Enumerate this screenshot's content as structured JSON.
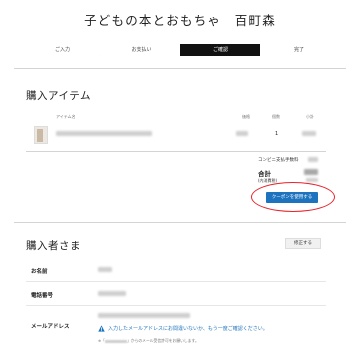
{
  "store": {
    "title": "子どもの本とおもちゃ　百町森"
  },
  "steps": [
    {
      "label": "ご入力",
      "active": false
    },
    {
      "label": "お支払い",
      "active": false
    },
    {
      "label": "ご確認",
      "active": true
    },
    {
      "label": "完了",
      "active": false
    }
  ],
  "items_section": {
    "heading": "購入アイテム",
    "columns": {
      "item": "アイテム名",
      "price": "価格",
      "qty": "個数",
      "subtotal": "小計"
    },
    "qty_value": "1"
  },
  "totals": {
    "fee_label": "コンビニ支払手数料",
    "total_label": "合計",
    "tax_note": "(内消費税)",
    "coupon_button": "クーポンを使用する"
  },
  "buyer_section": {
    "heading": "購入者さま",
    "edit_button": "修正する",
    "name_label": "お名前",
    "phone_label": "電話番号",
    "email_label": "メールアドレス",
    "email_warning": "入力したメールアドレスにお間違いないか、もう一度ご確認ください。",
    "note_prefix": "※「",
    "note_suffix": "」からのメール受信許可をお願いします。"
  },
  "colors": {
    "accent_blue": "#1e73be",
    "annotation_red": "#e8232c",
    "active_step": "#111111"
  }
}
